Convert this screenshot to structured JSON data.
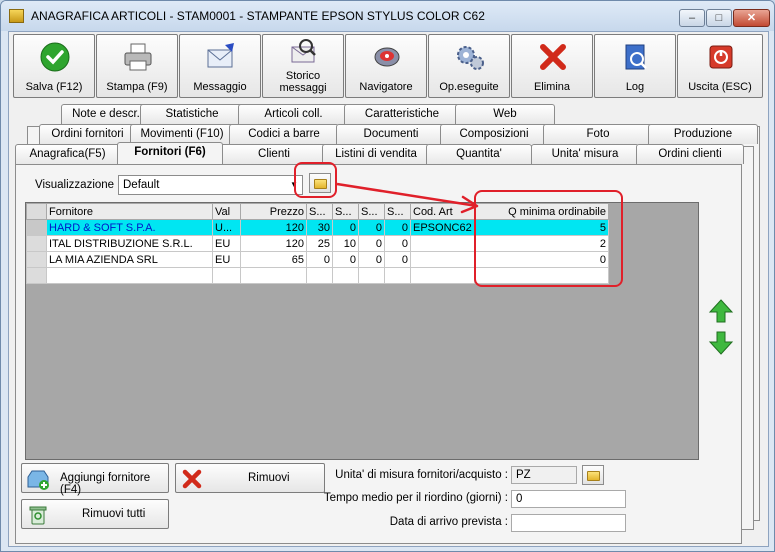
{
  "window": {
    "title": "ANAGRAFICA ARTICOLI - STAM0001 - STAMPANTE EPSON STYLUS COLOR C62",
    "controls": {
      "minimize": "–",
      "maximize": "□",
      "close": "✕"
    }
  },
  "toolbar": [
    {
      "label": "Salva (F12)",
      "icon": "check-icon"
    },
    {
      "label": "Stampa (F9)",
      "icon": "printer-icon"
    },
    {
      "label": "Messaggio",
      "icon": "envelope-pen-icon"
    },
    {
      "label": "Storico\nmessaggi",
      "icon": "message-history-icon"
    },
    {
      "label": "Navigatore",
      "icon": "navigator-icon"
    },
    {
      "label": "Op.eseguite",
      "icon": "gears-icon"
    },
    {
      "label": "Elimina",
      "icon": "delete-x-icon"
    },
    {
      "label": "Log",
      "icon": "log-book-icon"
    },
    {
      "label": "Uscita (ESC)",
      "icon": "exit-icon"
    }
  ],
  "tabs": {
    "row1": [
      "Note e descr.",
      "Statistiche",
      "Articoli coll.",
      "Caratteristiche",
      "Web"
    ],
    "row2": [
      "Ordini fornitori",
      "Movimenti (F10)",
      "Codici a barre",
      "Documenti",
      "Composizioni",
      "Foto",
      "Produzione"
    ],
    "row3": [
      "Anagrafica(F5)",
      "Fornitori (F6)",
      "Clienti",
      "Listini di vendita",
      "Quantita'",
      "Unita' misura",
      "Ordini clienti"
    ],
    "active": "Fornitori (F6)"
  },
  "view": {
    "label": "Visualizzazione :",
    "value": "Default"
  },
  "grid": {
    "columns": [
      "Fornitore",
      "Val",
      "Prezzo",
      "S...",
      "S...",
      "S...",
      "S...",
      "Cod. Art",
      "Q minima ordinabile"
    ],
    "rows": [
      [
        "HARD & SOFT S.P.A.",
        "U...",
        "120",
        "30",
        "0",
        "0",
        "0",
        "EPSONC62",
        "5"
      ],
      [
        "ITAL DISTRIBUZIONE S.R.L.",
        "EU",
        "120",
        "25",
        "10",
        "0",
        "0",
        "",
        "2"
      ],
      [
        "LA MIA AZIENDA SRL",
        "EU",
        "65",
        "0",
        "0",
        "0",
        "0",
        "",
        "0"
      ],
      [
        "",
        "",
        "",
        "",
        "",
        "",
        "",
        "",
        ""
      ]
    ],
    "selected_row": 0
  },
  "buttons": {
    "add_supplier": "Aggiungi fornitore (F4)",
    "remove": "Rimuovi",
    "remove_all": "Rimuovi tutti"
  },
  "fields": {
    "unit_label": "Unita' di misura fornitori/acquisto :",
    "unit_value": "PZ",
    "lead_time_label": "Tempo medio per il riordino (giorni) :",
    "lead_time_value": "0",
    "arrival_label": "Data di arrivo prevista :",
    "arrival_value": ""
  },
  "colors": {
    "selection": "#00e6f2",
    "highlight": "#e0202a"
  }
}
